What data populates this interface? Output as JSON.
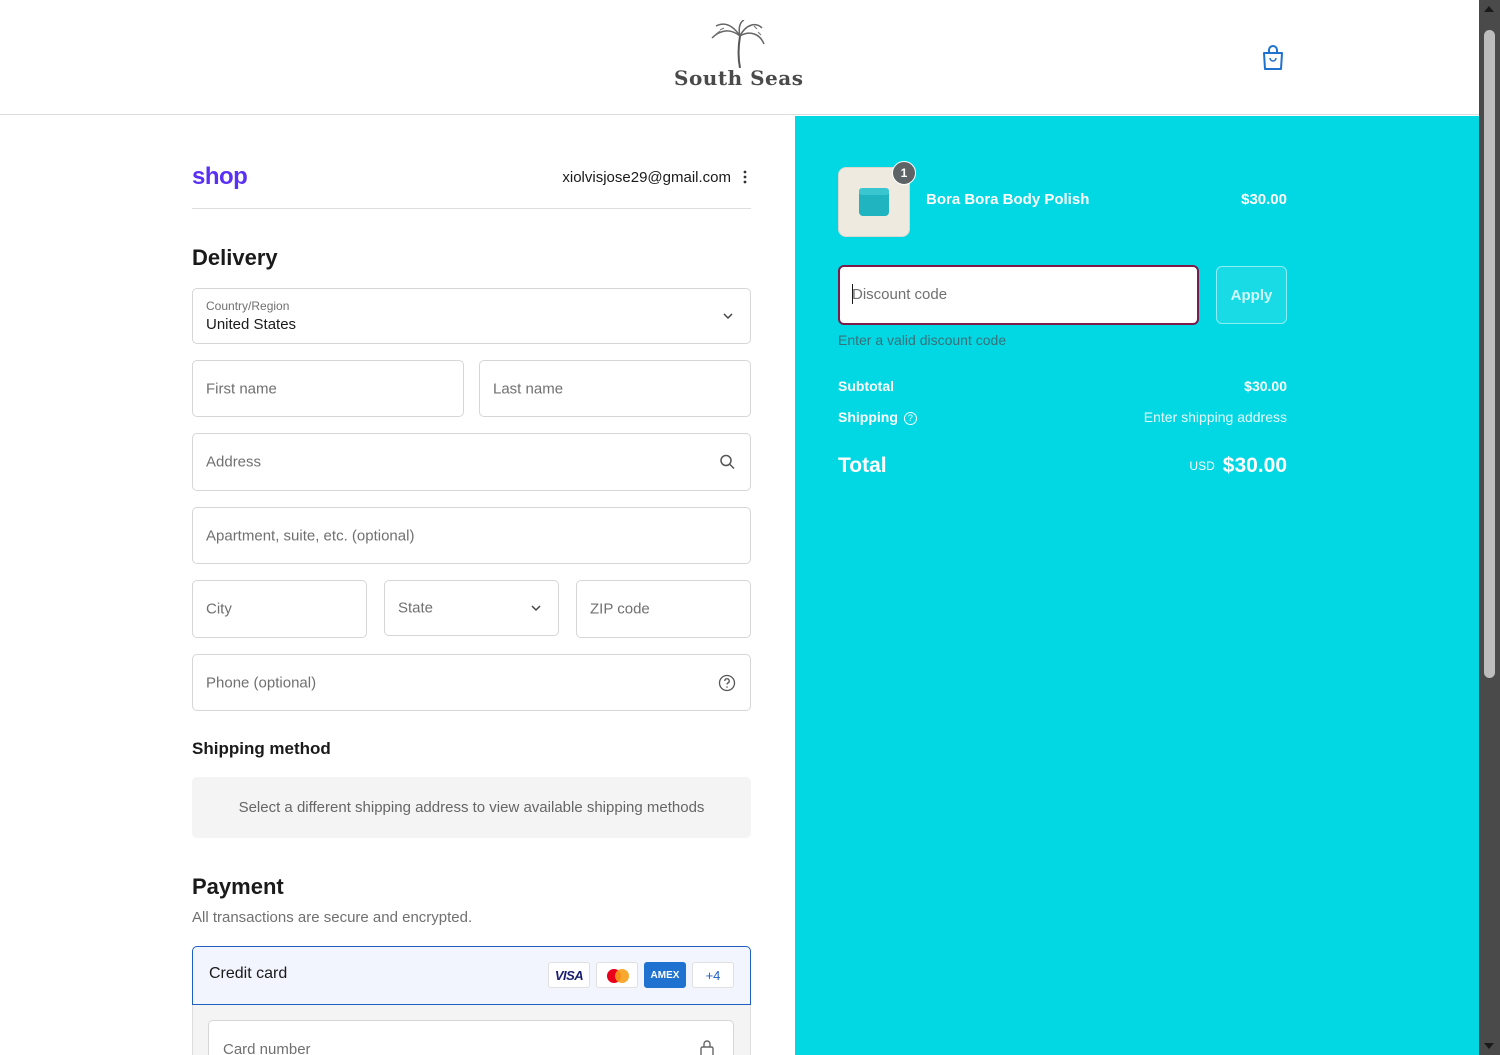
{
  "header": {
    "brand": "South Seas",
    "cart_icon": "shopping-bag-icon"
  },
  "account": {
    "shop_logo": "shop",
    "email": "xiolvisjose29@gmail.com",
    "menu_icon": "vertical-dots-icon"
  },
  "delivery": {
    "heading": "Delivery",
    "country_label": "Country/Region",
    "country_value": "United States",
    "first_name_placeholder": "First name",
    "last_name_placeholder": "Last name",
    "address_placeholder": "Address",
    "apartment_placeholder": "Apartment, suite, etc. (optional)",
    "city_placeholder": "City",
    "state_placeholder": "State",
    "zip_placeholder": "ZIP code",
    "phone_placeholder": "Phone (optional)"
  },
  "shipping_method": {
    "heading": "Shipping method",
    "notice": "Select a different shipping address to view available shipping methods"
  },
  "payment": {
    "heading": "Payment",
    "subtitle": "All transactions are secure and encrypted.",
    "method_label": "Credit card",
    "badges": [
      "VISA",
      "AMEX",
      "+4"
    ],
    "card_number_placeholder": "Card number"
  },
  "order": {
    "item_name": "Bora Bora Body Polish",
    "item_price": "$30.00",
    "item_quantity": "1",
    "discount_placeholder": "Discount code",
    "apply_label": "Apply",
    "discount_error": "Enter a valid discount code",
    "subtotal_label": "Subtotal",
    "subtotal_value": "$30.00",
    "shipping_label": "Shipping",
    "shipping_value": "Enter shipping address",
    "total_label": "Total",
    "currency": "USD",
    "total_value": "$30.00"
  },
  "colors": {
    "summary_bg": "#01d8e3",
    "shop_purple": "#5a31f4",
    "focus_border": "#7b1c4b",
    "selected_border": "#1f5fbf"
  }
}
